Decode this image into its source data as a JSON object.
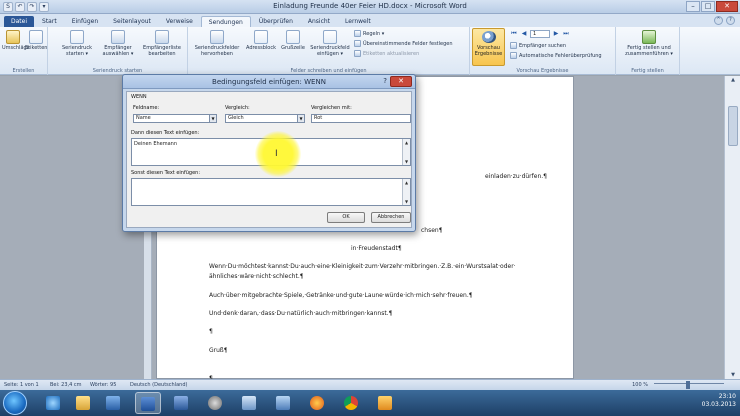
{
  "window": {
    "title": "Einladung Freunde 40er Feier HD.docx - Microsoft Word",
    "controls": [
      "–",
      "□",
      "✕"
    ]
  },
  "qat": [
    "S",
    "↶",
    "↷",
    "▾"
  ],
  "tabs": [
    "Datei",
    "Start",
    "Einfügen",
    "Seitenlayout",
    "Verweise",
    "Sendungen",
    "Überprüfen",
    "Ansicht",
    "Lernwelt"
  ],
  "active_tab": "Sendungen",
  "ribbon": {
    "groups": {
      "erstellen": "Erstellen",
      "start": "Seriendruck starten",
      "felder": "Felder schreiben und einfügen",
      "vorschau": "Vorschau Ergebnisse",
      "fertig": "Fertig stellen"
    },
    "buttons": {
      "umschlaege": "Umschläge",
      "etiketten": "Etiketten",
      "seriendruck_starten": "Seriendruck starten ▾",
      "empfaenger_auswaehlen": "Empfänger auswählen ▾",
      "empfaengerliste": "Empfängerliste bearbeiten",
      "seriendruckfelder": "Seriendruckfelder hervorheben",
      "adressblock": "Adressblock",
      "grusszeile": "Grußzeile",
      "feld_einfuegen": "Seriendruckfeld einfügen ▾",
      "regeln": "Regeln ▾",
      "uebereinstimmende": "Übereinstimmende Felder festlegen",
      "etiketten_aktualisieren": "Etiketten aktualisieren",
      "vorschau": "Vorschau Ergebnisse",
      "empfaenger_suchen": "Empfänger suchen",
      "fehlerueberpruefung": "Automatische Fehlerüberprüfung",
      "fertig_stellen": "Fertig stellen und zusammenführen ▾"
    },
    "record": "1",
    "nav": [
      "⏮",
      "◀",
      "▶",
      "⏭"
    ]
  },
  "document": {
    "lines": [
      "einladen·zu·dürfen.¶",
      "chsen¶",
      "in·Freudenstadt¶",
      "Wenn·Du·möchtest·kannst·Du·auch·eine·Kleinigkeit·zum·Verzehr·mitbringen.·Z.B.·ein·Wurstsalat·oder·",
      "ähnliches·wäre·nicht·schlecht.¶",
      "Auch·über·mitgebrachte·Spiele,·Getränke·und·gute·Laune·würde·ich·mich·sehr·freuen.¶",
      "Und·denk·daran,·dass·Du·natürlich·auch·mitbringen·kannst.¶",
      "¶",
      "Gruß¶",
      "¶"
    ]
  },
  "dialog": {
    "title": "Bedingungsfeld einfügen: WENN",
    "help": "?",
    "close": "✕",
    "section": "WENN",
    "feldname_label": "Feldname:",
    "feldname_value": "Name",
    "vergleich_label": "Vergleich:",
    "vergleich_value": "Gleich",
    "vergleichen_mit_label": "Vergleichen mit:",
    "vergleichen_mit_value": "Rot",
    "dann_label": "Dann diesen Text einfügen:",
    "dann_value": "Deinen Ehemann",
    "sonst_label": "Sonst diesen Text einfügen:",
    "sonst_value": "",
    "ok": "OK",
    "cancel": "Abbrechen"
  },
  "status": {
    "page": "Seite: 1 von 1",
    "position": "Bei: 23,4 cm",
    "words": "Wörter: 95",
    "language": "Deutsch (Deutschland)",
    "zoom": "100 %"
  },
  "taskbar": {
    "apps": [
      "ie-icon",
      "folder-icon",
      "outlook-icon",
      "word-icon",
      "word-doc-icon",
      "settings-icon",
      "network-icon",
      "media-icon",
      "firefox-icon",
      "chrome-icon",
      "player-icon"
    ],
    "time": "23:10",
    "date": "03.03.2013"
  },
  "colors": {
    "word_blue": "#2b5797",
    "ribbon_bg": "#dce7f4",
    "highlight": "#fff832",
    "close_red": "#c9493b"
  }
}
